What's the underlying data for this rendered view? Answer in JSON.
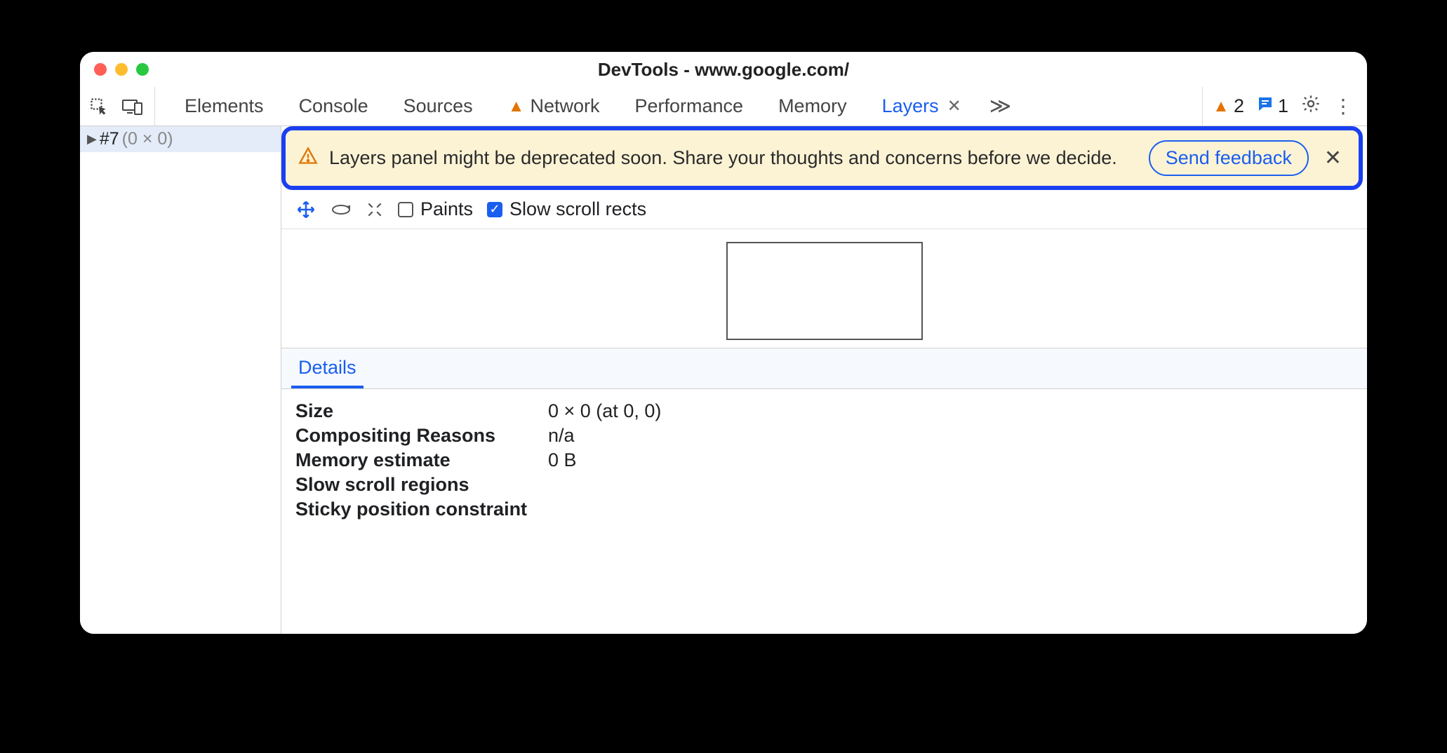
{
  "window": {
    "title": "DevTools - www.google.com/"
  },
  "toolbar": {
    "tabs": {
      "elements": "Elements",
      "console": "Console",
      "sources": "Sources",
      "network": "Network",
      "performance": "Performance",
      "memory": "Memory",
      "layers": "Layers"
    },
    "issues_count": "2",
    "messages_count": "1"
  },
  "sidebar": {
    "layer_name": "#7",
    "layer_dim": "(0 × 0)"
  },
  "banner": {
    "text": "Layers panel might be deprecated soon. Share your thoughts and concerns before we decide.",
    "button": "Send feedback"
  },
  "view_toolbar": {
    "paints": "Paints",
    "slow_scroll": "Slow scroll rects"
  },
  "details": {
    "tab": "Details",
    "rows": {
      "size": {
        "label": "Size",
        "value": "0 × 0 (at 0, 0)"
      },
      "compositing": {
        "label": "Compositing Reasons",
        "value": "n/a"
      },
      "memory": {
        "label": "Memory estimate",
        "value": "0 B"
      },
      "slow_scroll": {
        "label": "Slow scroll regions",
        "value": ""
      },
      "sticky": {
        "label": "Sticky position constraint",
        "value": ""
      }
    }
  }
}
